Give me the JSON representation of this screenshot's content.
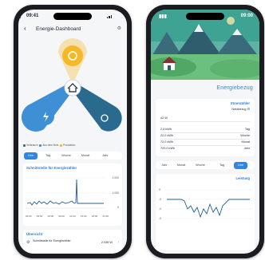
{
  "left": {
    "status": {
      "time": "09:41"
    },
    "header": {
      "title": "Energie-Dashboard"
    },
    "legend": [
      "Verbrauch",
      "Aus dem Netz",
      "Produktion"
    ],
    "tabs": [
      "Live",
      "Tag",
      "Woche",
      "Monat",
      "Jahr"
    ],
    "active_tab": "Live",
    "chart": {
      "title": "Schnittstelle für Energiezähler",
      "y_ticks": [
        "2.000",
        "1.000",
        "0"
      ],
      "x_ticks": [
        "00:00",
        "03:00",
        "06:00",
        "09:00",
        "12:00",
        "15:00",
        "18:00",
        "21:00"
      ]
    },
    "overview": {
      "title": "Übersicht",
      "item_label": "Schnittstelle für Energiezähler",
      "item_value": "2.038 W"
    },
    "colors": {
      "sun": "#f5b829",
      "grid": "#3e8fd6",
      "consumer": "#2a6a8e",
      "accent": "#2f86e6"
    }
  },
  "right": {
    "status": {
      "time": "09:00"
    },
    "hero": {
      "title": "Energiebezug"
    },
    "card1": {
      "title": "Stromzähler",
      "subtitle": "Netzbezug",
      "value": "42 W",
      "rows": [
        {
          "label": "Tag",
          "value": "2,0 kWh"
        },
        {
          "label": "Woche",
          "value": "22,0 kWh"
        },
        {
          "label": "Monat",
          "value": "72,0 kWh"
        },
        {
          "label": "Jahr",
          "value": "720,0 kWh"
        }
      ]
    },
    "tabs": [
      "Live",
      "Tag",
      "Woche",
      "Monat",
      "Jahr"
    ],
    "active_tab": "Live",
    "chart": {
      "title": "Leistung",
      "y_ticks": [
        "0",
        "-0",
        "-0",
        "-0"
      ]
    }
  }
}
